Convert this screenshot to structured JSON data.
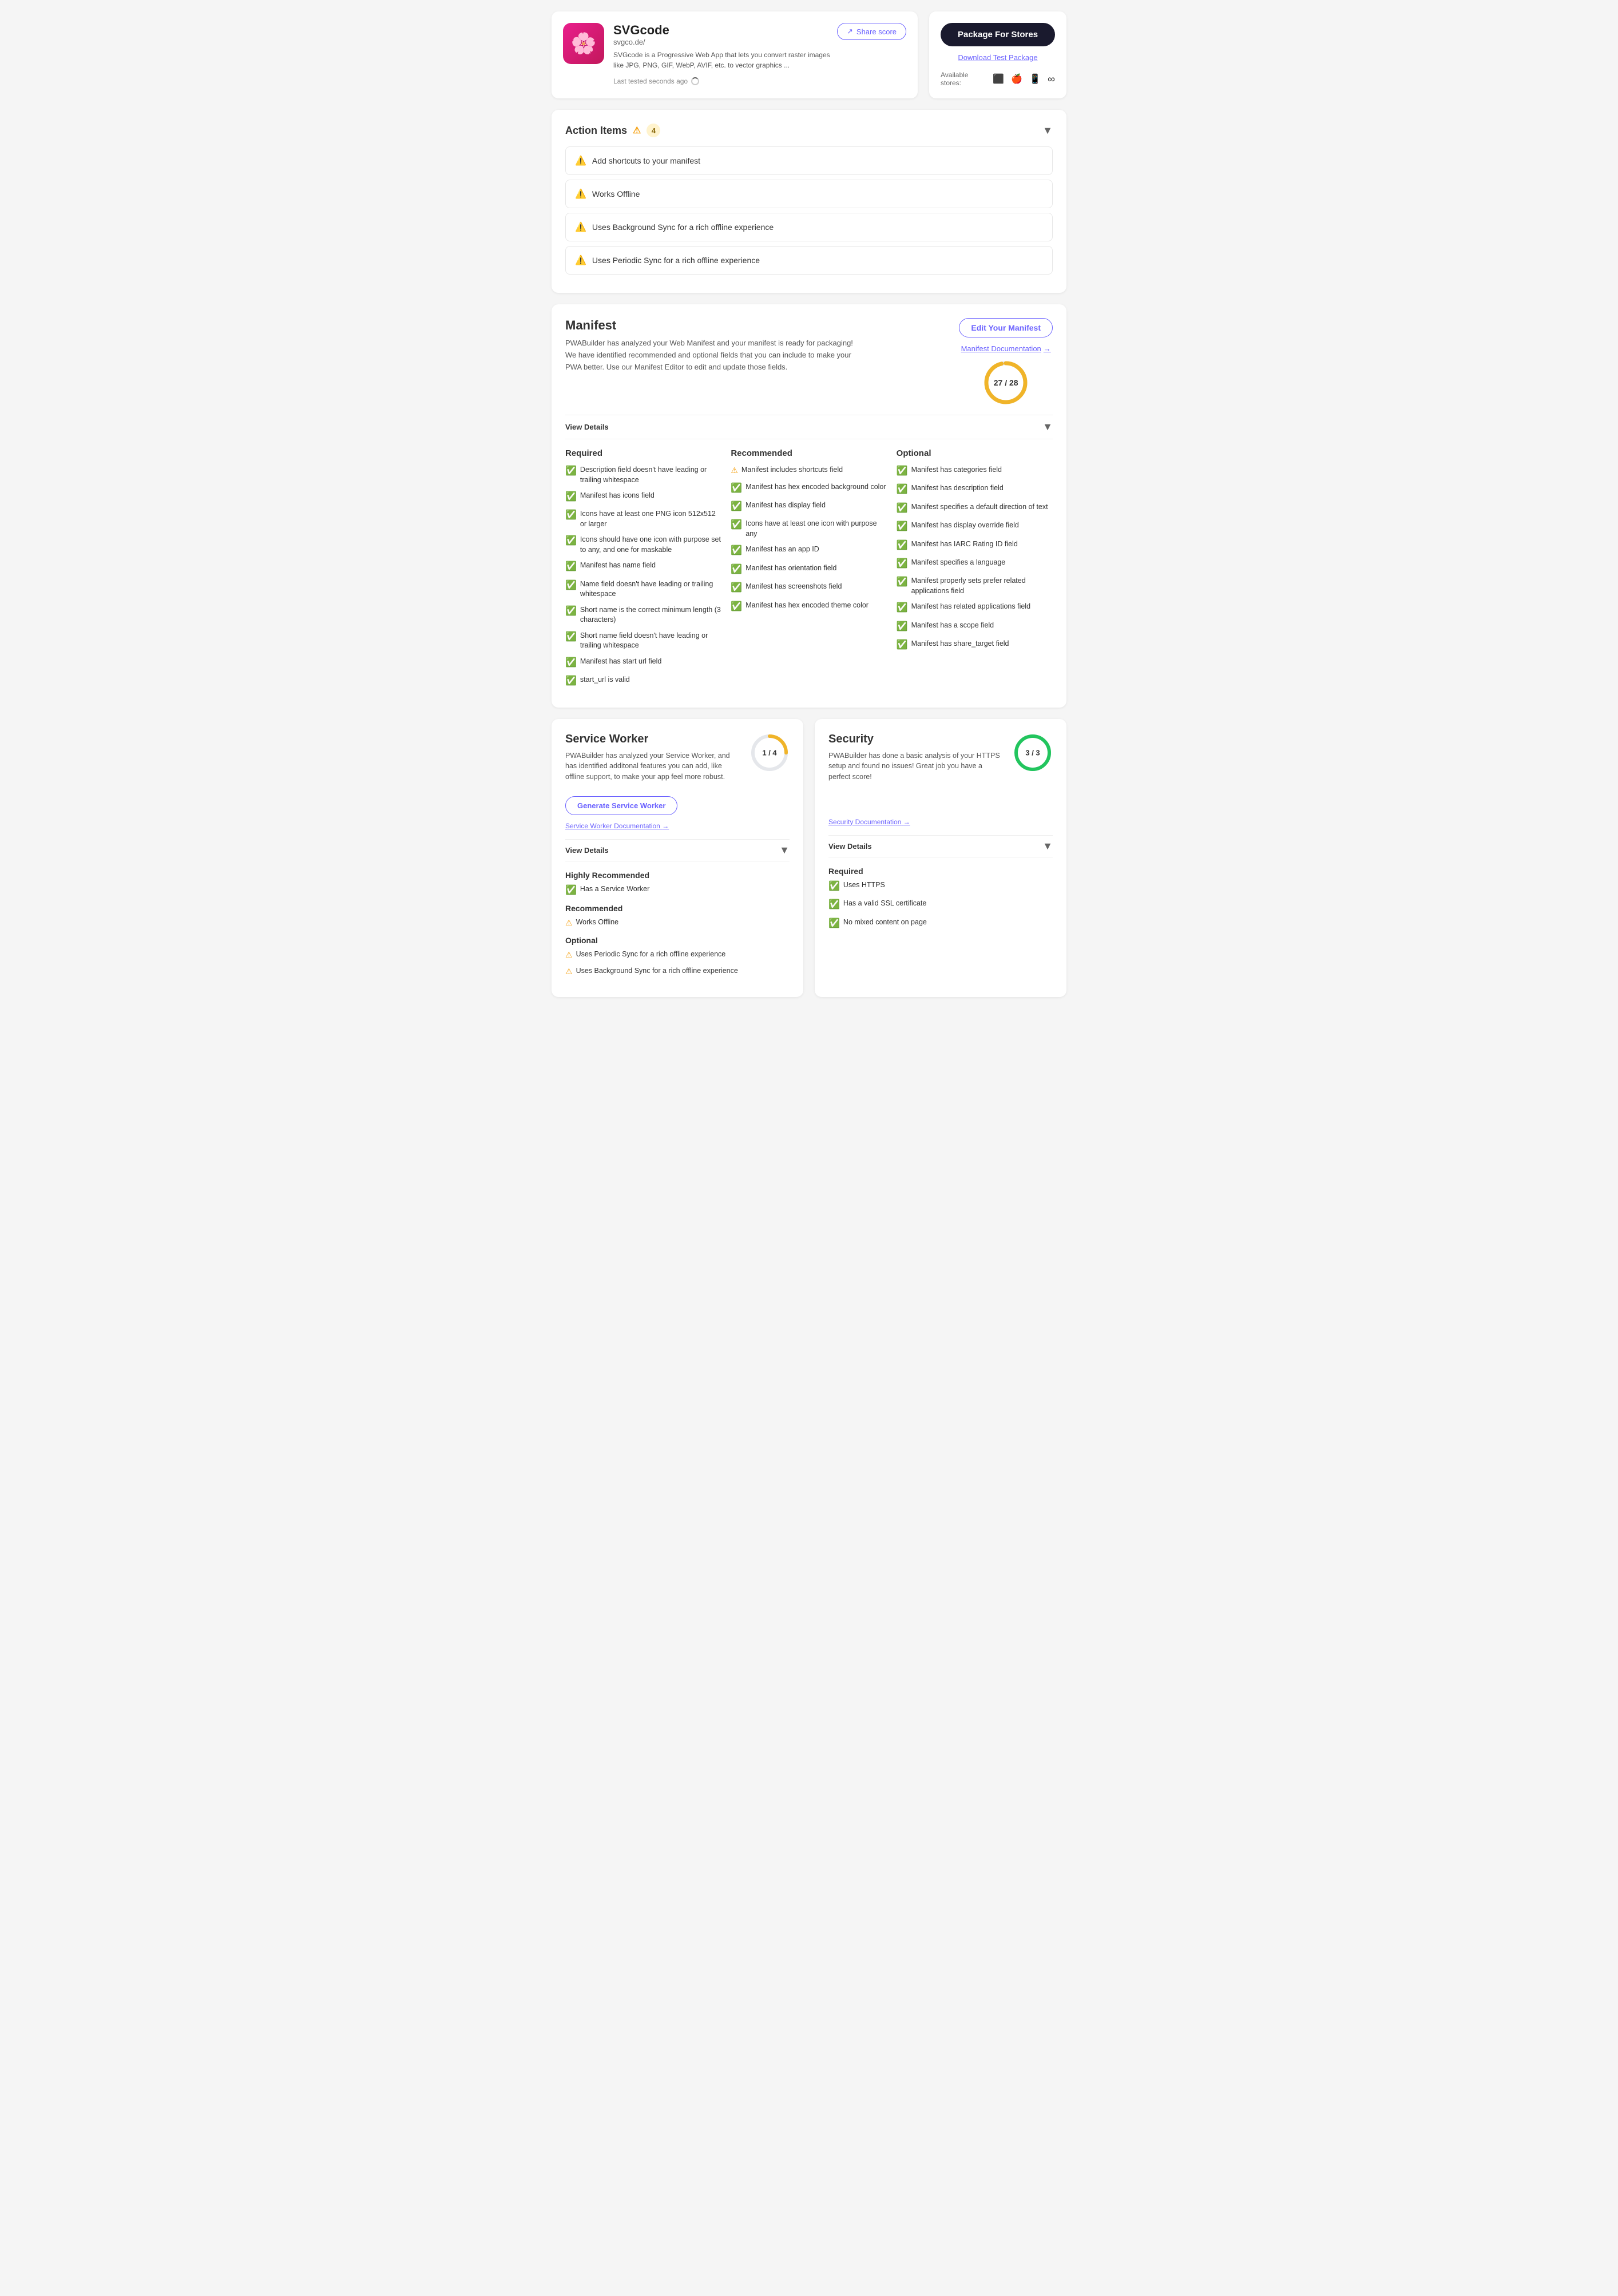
{
  "app": {
    "name": "SVGcode",
    "url": "svgco.de/",
    "description": "SVGcode is a Progressive Web App that lets you convert raster images like JPG, PNG, GIF, WebP, AVIF, etc. to vector graphics ...",
    "logo_emoji": "🌸"
  },
  "header": {
    "share_score_label": "Share score",
    "last_tested": "Last tested seconds ago",
    "package_btn_label": "Package For Stores",
    "download_test_label": "Download Test Package",
    "available_stores_label": "Available stores:"
  },
  "action_items": {
    "title": "Action Items",
    "count": "4",
    "items": [
      {
        "text": "Add shortcuts to your manifest",
        "type": "warning"
      },
      {
        "text": "Works Offline",
        "type": "warning"
      },
      {
        "text": "Uses Background Sync for a rich offline experience",
        "type": "warning"
      },
      {
        "text": "Uses Periodic Sync for a rich offline experience",
        "type": "warning"
      }
    ]
  },
  "manifest": {
    "title": "Manifest",
    "description": "PWABuilder has analyzed your Web Manifest and your manifest is ready for packaging! We have identified recommended and optional fields that you can include to make your PWA better. Use our Manifest Editor to edit and update those fields.",
    "edit_btn": "Edit Your Manifest",
    "doc_link": "Manifest Documentation",
    "score_current": "27",
    "score_total": "28",
    "score_display": "27 / 28",
    "view_details": "View Details",
    "required": {
      "title": "Required",
      "items": [
        {
          "text": "Description field doesn't have leading or trailing whitespace",
          "pass": true
        },
        {
          "text": "Manifest has icons field",
          "pass": true
        },
        {
          "text": "Icons have at least one PNG icon 512x512 or larger",
          "pass": true
        },
        {
          "text": "Icons should have one icon with purpose set to any, and one for maskable",
          "pass": true
        },
        {
          "text": "Manifest has name field",
          "pass": true
        },
        {
          "text": "Name field doesn't have leading or trailing whitespace",
          "pass": true
        },
        {
          "text": "Short name is the correct minimum length (3 characters)",
          "pass": true
        },
        {
          "text": "Short name field doesn't have leading or trailing whitespace",
          "pass": true
        },
        {
          "text": "Manifest has start url field",
          "pass": true
        },
        {
          "text": "start_url is valid",
          "pass": true
        }
      ]
    },
    "recommended": {
      "title": "Recommended",
      "items": [
        {
          "text": "Manifest includes shortcuts field",
          "pass": false
        },
        {
          "text": "Manifest has hex encoded background color",
          "pass": true
        },
        {
          "text": "Manifest has display field",
          "pass": true
        },
        {
          "text": "Icons have at least one icon with purpose any",
          "pass": true
        },
        {
          "text": "Manifest has an app ID",
          "pass": true
        },
        {
          "text": "Manifest has orientation field",
          "pass": true
        },
        {
          "text": "Manifest has screenshots field",
          "pass": true
        },
        {
          "text": "Manifest has hex encoded theme color",
          "pass": true
        }
      ]
    },
    "optional": {
      "title": "Optional",
      "items": [
        {
          "text": "Manifest has categories field",
          "pass": true
        },
        {
          "text": "Manifest has description field",
          "pass": true
        },
        {
          "text": "Manifest specifies a default direction of text",
          "pass": true
        },
        {
          "text": "Manifest has display override field",
          "pass": true
        },
        {
          "text": "Manifest has IARC Rating ID field",
          "pass": true
        },
        {
          "text": "Manifest specifies a language",
          "pass": true
        },
        {
          "text": "Manifest properly sets prefer related applications field",
          "pass": true
        },
        {
          "text": "Manifest has related applications field",
          "pass": true
        },
        {
          "text": "Manifest has a scope field",
          "pass": true
        },
        {
          "text": "Manifest has share_target field",
          "pass": true
        }
      ]
    }
  },
  "service_worker": {
    "title": "Service Worker",
    "description": "PWABuilder has analyzed your Service Worker, and has identified additonal features you can add, like offline support, to make your app feel more robust.",
    "score_current": "1",
    "score_total": "4",
    "score_display": "1 / 4",
    "gen_btn": "Generate Service Worker",
    "doc_link": "Service Worker Documentation",
    "view_details": "View Details",
    "highly_recommended": {
      "title": "Highly Recommended",
      "items": [
        {
          "text": "Has a Service Worker",
          "pass": true
        }
      ]
    },
    "recommended": {
      "title": "Recommended",
      "items": [
        {
          "text": "Works Offline",
          "pass": false
        }
      ]
    },
    "optional": {
      "title": "Optional",
      "items": [
        {
          "text": "Uses Periodic Sync for a rich offline experience",
          "pass": false
        },
        {
          "text": "Uses Background Sync for a rich offline experience",
          "pass": false
        }
      ]
    }
  },
  "security": {
    "title": "Security",
    "description": "PWABuilder has done a basic analysis of your HTTPS setup and found no issues! Great job you have a perfect score!",
    "score_current": "3",
    "score_total": "3",
    "score_display": "3 / 3",
    "doc_link": "Security Documentation",
    "view_details": "View Details",
    "required": {
      "title": "Required",
      "items": [
        {
          "text": "Uses HTTPS",
          "pass": true
        },
        {
          "text": "Has a valid SSL certificate",
          "pass": true
        },
        {
          "text": "No mixed content on page",
          "pass": true
        }
      ]
    }
  },
  "colors": {
    "purple": "#6c63ff",
    "dark": "#1a1a2e",
    "green": "#22c55e",
    "yellow": "#f59e0b",
    "manifest_ring": "#f0b429",
    "sw_ring_bg": "#e5e7eb",
    "security_ring": "#22c55e"
  }
}
